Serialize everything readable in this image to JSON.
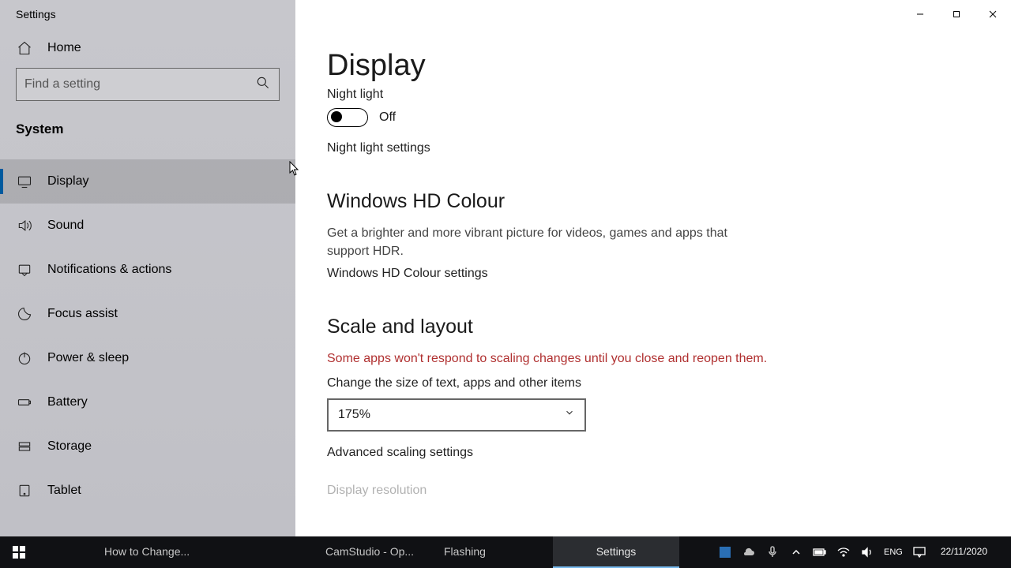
{
  "window": {
    "title": "Settings"
  },
  "home": {
    "label": "Home"
  },
  "search": {
    "placeholder": "Find a setting"
  },
  "section": {
    "title": "System"
  },
  "sidebar": {
    "items": [
      {
        "label": "Display",
        "active": true
      },
      {
        "label": "Sound"
      },
      {
        "label": "Notifications & actions"
      },
      {
        "label": "Focus assist"
      },
      {
        "label": "Power & sleep"
      },
      {
        "label": "Battery"
      },
      {
        "label": "Storage"
      },
      {
        "label": "Tablet"
      }
    ]
  },
  "main": {
    "title": "Display",
    "nightlight": {
      "label": "Night light",
      "state": "Off",
      "settings_link": "Night light settings"
    },
    "hdcolour": {
      "title": "Windows HD Colour",
      "desc": "Get a brighter and more vibrant picture for videos, games and apps that support HDR.",
      "settings_link": "Windows HD Colour settings"
    },
    "scale": {
      "title": "Scale and layout",
      "warn": "Some apps won't respond to scaling changes until you close and reopen them.",
      "size_label": "Change the size of text, apps and other items",
      "size_value": "175%",
      "advanced_link": "Advanced scaling settings",
      "cutoff_label": "Display resolution"
    }
  },
  "taskbar": {
    "tabs": [
      {
        "label": "How to Change..."
      },
      {
        "label": "CamStudio - Op..."
      },
      {
        "label": "Flashing"
      },
      {
        "label": "Settings",
        "active": true
      }
    ],
    "time": "",
    "date": "22/11/2020"
  }
}
